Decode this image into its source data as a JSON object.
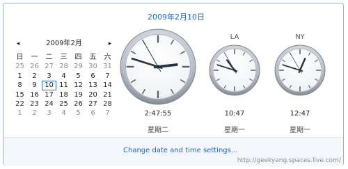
{
  "header": {
    "date": "2009年2月10日"
  },
  "calendar": {
    "prev_icon": "◂",
    "next_icon": "▸",
    "month_label": "2009年2月",
    "weekdays": [
      "日",
      "一",
      "二",
      "三",
      "四",
      "五",
      "六"
    ],
    "weeks": [
      [
        "25",
        "26",
        "27",
        "28",
        "29",
        "30",
        "31"
      ],
      [
        "1",
        "2",
        "3",
        "4",
        "5",
        "6",
        "7"
      ],
      [
        "8",
        "9",
        "10",
        "11",
        "12",
        "13",
        "14"
      ],
      [
        "15",
        "16",
        "17",
        "18",
        "19",
        "20",
        "21"
      ],
      [
        "22",
        "23",
        "24",
        "25",
        "26",
        "27",
        "28"
      ],
      [
        "1",
        "2",
        "3",
        "4",
        "5",
        "6",
        "7"
      ]
    ],
    "dim_weeks": [
      0,
      5
    ],
    "today": "10"
  },
  "clocks": [
    {
      "city": "",
      "time": "2:47:55",
      "day": "星期二",
      "hour": 2,
      "minute": 47,
      "second": 55
    },
    {
      "city": "LA",
      "time": "10:47",
      "day": "星期一",
      "hour": 10,
      "minute": 47,
      "second": 55
    },
    {
      "city": "NY",
      "time": "12:47",
      "day": "星期一",
      "hour": 12,
      "minute": 47,
      "second": 55
    }
  ],
  "footer": {
    "link": "Change date and time settings..."
  },
  "watermark": "http://geekyang.spaces.live.com/"
}
